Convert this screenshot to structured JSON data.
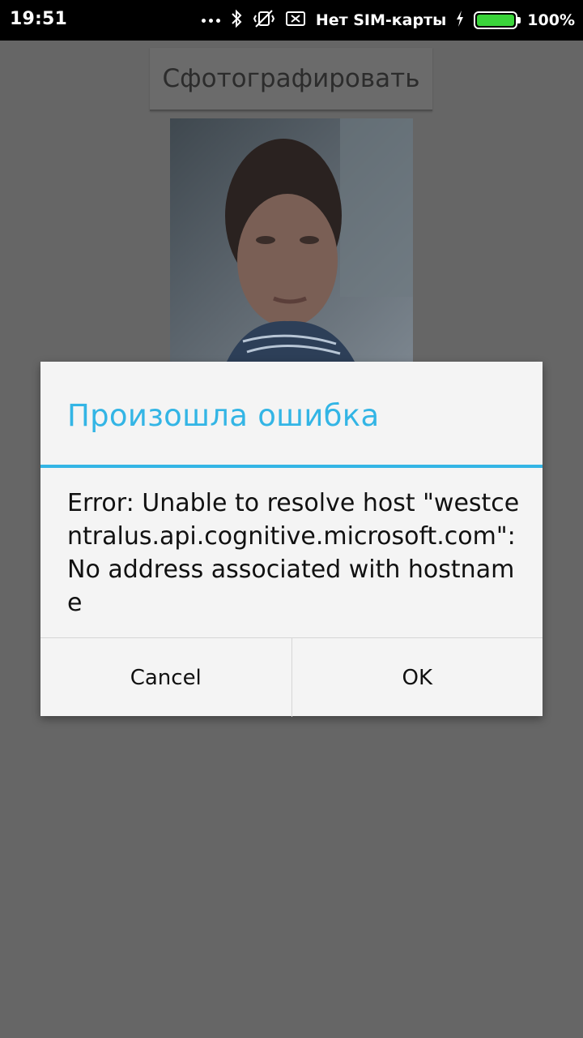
{
  "status_bar": {
    "time": "19:51",
    "carrier": "Нет SIM-карты",
    "battery_percent": "100%",
    "battery_level": 1.0,
    "battery_color": "#3ad43a",
    "icons": [
      "more-dots-icon",
      "bluetooth-icon",
      "vibrate-off-icon",
      "sim-blocked-icon",
      "charging-icon",
      "battery-icon"
    ]
  },
  "main": {
    "photo_button_label": "Сфотографировать",
    "photo_description": "portrait"
  },
  "dialog": {
    "title": "Произошла ошибка",
    "message": "Error: Unable to resolve host \"westcentralus.api.cognitive.microsoft.com\": No address associated with hostname",
    "cancel_label": "Cancel",
    "ok_label": "OK",
    "accent_color": "#33b5e5"
  }
}
